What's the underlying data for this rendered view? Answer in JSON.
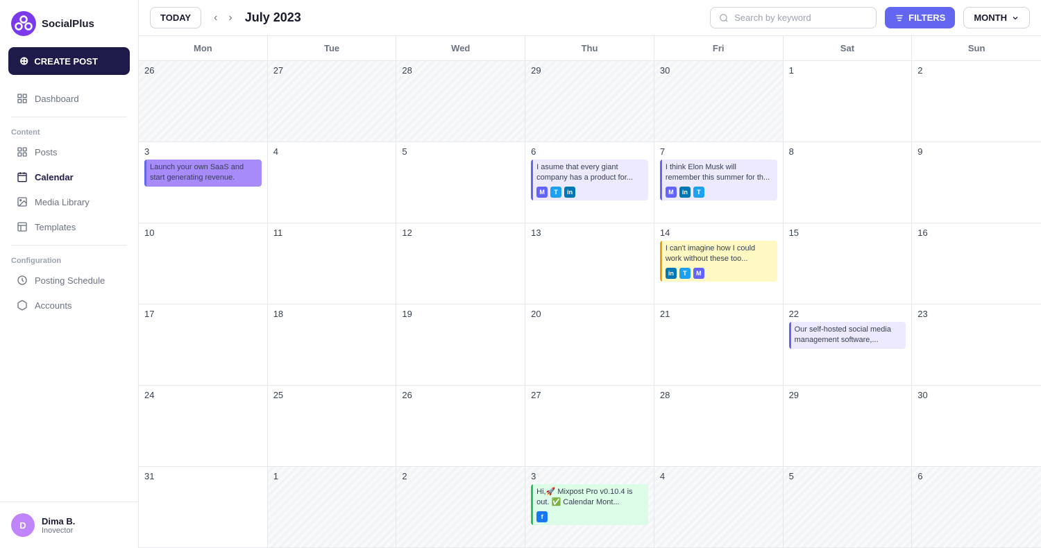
{
  "sidebar": {
    "logo_text": "SocialPlus",
    "create_post_label": "CREATE POST",
    "nav": {
      "content_label": "Content",
      "items": [
        {
          "id": "dashboard",
          "label": "Dashboard",
          "icon": "grid"
        },
        {
          "id": "posts",
          "label": "Posts",
          "icon": "list"
        },
        {
          "id": "calendar",
          "label": "Calendar",
          "icon": "calendar",
          "active": true
        },
        {
          "id": "media-library",
          "label": "Media Library",
          "icon": "image"
        },
        {
          "id": "templates",
          "label": "Templates",
          "icon": "template"
        }
      ],
      "config_label": "Configuration",
      "config_items": [
        {
          "id": "posting-schedule",
          "label": "Posting Schedule",
          "icon": "clock"
        },
        {
          "id": "accounts",
          "label": "Accounts",
          "icon": "box"
        }
      ]
    },
    "user": {
      "initials": "D",
      "name": "Dima B.",
      "role": "Inovector"
    }
  },
  "topbar": {
    "today_label": "TODAY",
    "month_label": "July 2023",
    "search_placeholder": "Search by keyword",
    "filters_label": "FILTERS",
    "view_label": "MONTH"
  },
  "calendar": {
    "day_headers": [
      "Mon",
      "Tue",
      "Wed",
      "Thu",
      "Fri",
      "Sat",
      "Sun"
    ],
    "weeks": [
      {
        "days": [
          {
            "num": "26",
            "other": true,
            "events": []
          },
          {
            "num": "27",
            "other": true,
            "events": []
          },
          {
            "num": "28",
            "other": true,
            "events": []
          },
          {
            "num": "29",
            "other": true,
            "events": []
          },
          {
            "num": "30",
            "other": true,
            "events": []
          },
          {
            "num": "1",
            "other": false,
            "events": []
          },
          {
            "num": "2",
            "other": false,
            "events": []
          }
        ]
      },
      {
        "days": [
          {
            "num": "3",
            "other": false,
            "events": [
              {
                "text": "Launch your own SaaS and start generating revenue.",
                "bar_color": "#6366f1",
                "accent": "#a78bfa",
                "icons": []
              }
            ]
          },
          {
            "num": "4",
            "other": false,
            "events": []
          },
          {
            "num": "5",
            "other": false,
            "events": []
          },
          {
            "num": "6",
            "other": false,
            "events": [
              {
                "text": "I asume that every giant company has a product for...",
                "bar_color": "#6366f1",
                "accent": "#ede9fe",
                "icons": [
                  "mastodon",
                  "twitter",
                  "linkedin"
                ]
              }
            ]
          },
          {
            "num": "7",
            "other": false,
            "events": [
              {
                "text": "I think Elon Musk will remember this summer for th...",
                "bar_color": "#6366f1",
                "accent": "#ede9fe",
                "icons": [
                  "mastodon",
                  "linkedin",
                  "twitter"
                ]
              }
            ]
          },
          {
            "num": "8",
            "other": false,
            "events": []
          },
          {
            "num": "9",
            "other": false,
            "events": []
          }
        ]
      },
      {
        "days": [
          {
            "num": "10",
            "other": false,
            "events": []
          },
          {
            "num": "11",
            "other": false,
            "events": []
          },
          {
            "num": "12",
            "other": false,
            "events": []
          },
          {
            "num": "13",
            "other": false,
            "events": []
          },
          {
            "num": "14",
            "other": false,
            "events": [
              {
                "text": "I can't imagine how I could work without these too...",
                "bar_color": "#f59e0b",
                "accent": "#fef9c3",
                "icons": [
                  "linkedin",
                  "twitter",
                  "mastodon"
                ]
              }
            ]
          },
          {
            "num": "15",
            "other": false,
            "events": []
          },
          {
            "num": "16",
            "other": false,
            "events": []
          }
        ]
      },
      {
        "days": [
          {
            "num": "17",
            "other": false,
            "events": []
          },
          {
            "num": "18",
            "other": false,
            "events": []
          },
          {
            "num": "19",
            "other": false,
            "events": []
          },
          {
            "num": "20",
            "other": false,
            "events": []
          },
          {
            "num": "21",
            "other": false,
            "events": []
          },
          {
            "num": "22",
            "other": false,
            "events": [
              {
                "text": "Our self-hosted social media management software,...",
                "bar_color": "#6366f1",
                "accent": "#ede9fe",
                "icons": []
              }
            ]
          },
          {
            "num": "23",
            "other": false,
            "events": []
          }
        ]
      },
      {
        "days": [
          {
            "num": "24",
            "other": false,
            "events": []
          },
          {
            "num": "25",
            "other": false,
            "events": []
          },
          {
            "num": "26",
            "other": false,
            "events": []
          },
          {
            "num": "27",
            "other": false,
            "events": []
          },
          {
            "num": "28",
            "other": false,
            "events": []
          },
          {
            "num": "29",
            "other": false,
            "events": []
          },
          {
            "num": "30",
            "other": false,
            "events": []
          }
        ]
      },
      {
        "days": [
          {
            "num": "31",
            "other": false,
            "events": []
          },
          {
            "num": "1",
            "other": true,
            "events": []
          },
          {
            "num": "2",
            "other": true,
            "events": []
          },
          {
            "num": "3",
            "other": true,
            "events": [
              {
                "text": "Hi,🚀 Mixpost Pro v0.10.4 is out. ✅ Calendar Mont...",
                "bar_color": "#22c55e",
                "accent": "#dcfce7",
                "icons": [
                  "facebook"
                ]
              }
            ]
          },
          {
            "num": "4",
            "other": true,
            "events": []
          },
          {
            "num": "5",
            "other": true,
            "events": []
          },
          {
            "num": "6",
            "other": true,
            "events": []
          }
        ]
      }
    ]
  }
}
